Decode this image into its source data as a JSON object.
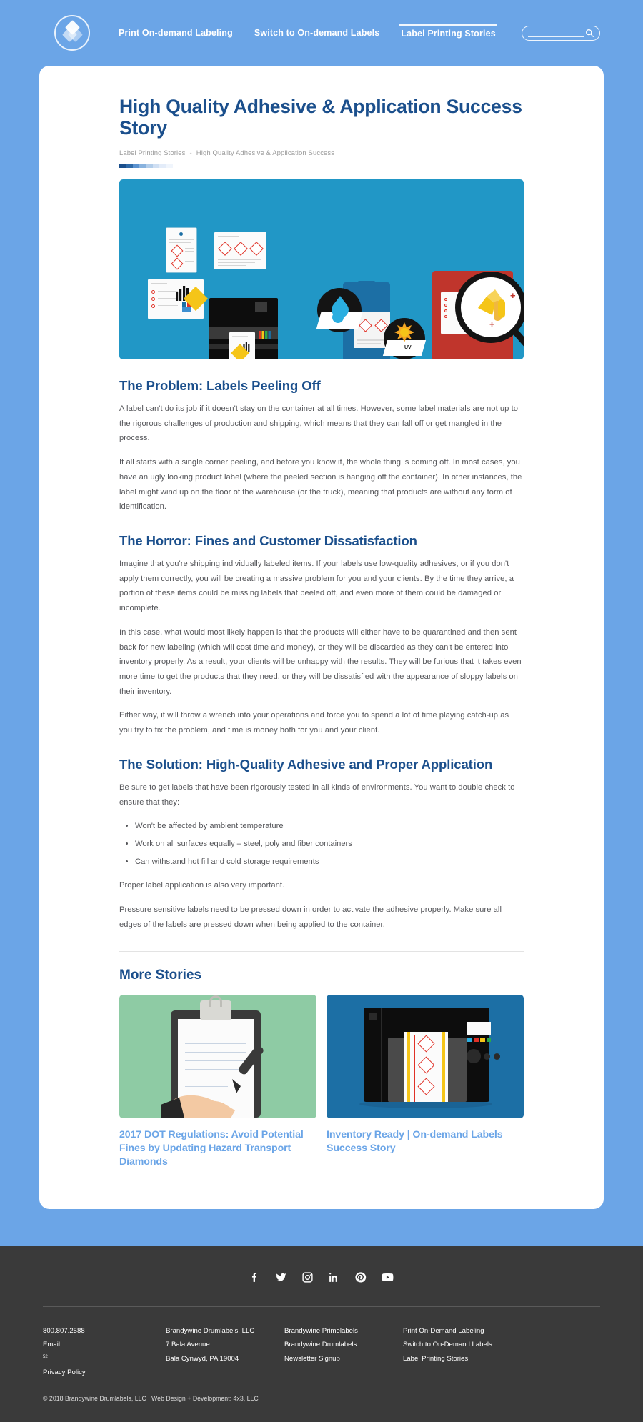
{
  "header": {
    "logo_name": "brandywine-logo",
    "nav": [
      {
        "label": "Print On-demand Labeling",
        "active": false
      },
      {
        "label": "Switch to On-demand Labels",
        "active": false
      },
      {
        "label": "Label Printing Stories",
        "active": true
      }
    ],
    "search": {
      "placeholder": "",
      "value": "",
      "icon": "search-icon"
    }
  },
  "article": {
    "title": "High Quality Adhesive & Application Success Story",
    "breadcrumb": {
      "parent": "Label Printing Stories",
      "separator": "-",
      "current": "High Quality Adhesive & Application Success"
    },
    "hero_alt": "label-printing-workflow-illustration",
    "sections": [
      {
        "heading": "The Problem: Labels Peeling Off",
        "paragraphs": [
          "A label can't do its job if it doesn't stay on the container at all times. However, some label materials are not up to the rigorous challenges of production and shipping, which means that they can fall off or get mangled in the process.",
          "It all starts with a single corner peeling, and before you know it, the whole thing is coming off. In most cases, you have an ugly looking product label (where the peeled section is hanging off the container). In other instances, the label might wind up on the floor of the warehouse (or the truck), meaning that products are without any form of identification."
        ]
      },
      {
        "heading": "The Horror: Fines and Customer Dissatisfaction",
        "paragraphs": [
          "Imagine that you're shipping individually labeled items. If your labels use low-quality adhesives, or if you don't apply them correctly, you will be creating a massive problem for you and your clients. By the time they arrive, a portion of these items could be missing labels that peeled off, and even more of them could be damaged or incomplete.",
          "In this case, what would most likely happen is that the products will either have to be quarantined and then sent back for new labeling (which will cost time and money), or they will be discarded as they can't be entered into inventory properly. As a result, your clients will be unhappy with the results. They will be furious that it takes even more time to get the products that they need, or they will be dissatisfied with the appearance of sloppy labels on their inventory.",
          "Either way, it will throw a wrench into your operations and force you to spend a lot of time playing catch-up as you try to fix the problem, and time is money both for you and your client."
        ]
      },
      {
        "heading": "The Solution: High-Quality Adhesive and Proper Application",
        "paragraphs": [
          "Be sure to get labels that have been rigorously tested in all kinds of environments. You want to double check to ensure that they:"
        ],
        "list": [
          "Won't be affected by ambient temperature",
          "Work on all surfaces equally – steel, poly and fiber containers",
          "Can withstand hot fill and cold storage requirements"
        ],
        "paragraphs_after": [
          "Proper label application is also very important.",
          "Pressure sensitive labels need to be pressed down in order to activate the adhesive properly. Make sure all edges of the labels are pressed down when being applied to the container."
        ]
      }
    ]
  },
  "more_stories": {
    "heading": "More Stories",
    "cards": [
      {
        "title": "2017 DOT Regulations: Avoid Potential Fines by Updating Hazard Transport Diamonds",
        "thumb_alt": "clipboard-hand-writing-illustration",
        "thumb_bg": "#8ecba4"
      },
      {
        "title": "Inventory Ready | On-demand Labels Success Story",
        "thumb_alt": "label-printer-illustration",
        "thumb_bg": "#1c6fa5"
      }
    ]
  },
  "footer": {
    "social": [
      {
        "name": "facebook-icon",
        "glyph": "f"
      },
      {
        "name": "twitter-icon",
        "glyph": "t"
      },
      {
        "name": "instagram-icon",
        "glyph": "i"
      },
      {
        "name": "linkedin-icon",
        "glyph": "in"
      },
      {
        "name": "pinterest-icon",
        "glyph": "p"
      },
      {
        "name": "youtube-icon",
        "glyph": "yt"
      }
    ],
    "columns": [
      {
        "items": [
          {
            "label": "800.807.2588",
            "sup": ""
          },
          {
            "label": "Email",
            "sup": "52"
          },
          {
            "label": "Privacy Policy",
            "sup": ""
          }
        ]
      },
      {
        "items": [
          {
            "label": "Brandywine Drumlabels, LLC",
            "sup": ""
          },
          {
            "label": "7 Bala Avenue",
            "sup": ""
          },
          {
            "label": "Bala Cynwyd, PA 19004",
            "sup": ""
          }
        ]
      },
      {
        "items": [
          {
            "label": "Brandywine Primelabels",
            "sup": ""
          },
          {
            "label": "Brandywine Drumlabels",
            "sup": ""
          },
          {
            "label": "Newsletter Signup",
            "sup": ""
          }
        ]
      },
      {
        "items": [
          {
            "label": "Print On-Demand Labeling",
            "sup": ""
          },
          {
            "label": "Switch to On-Demand Labels",
            "sup": ""
          },
          {
            "label": "Label Printing Stories",
            "sup": ""
          }
        ]
      }
    ],
    "copyright": "© 2018 Brandywine Drumlabels, LLC | Web Design + Development: 4x3, LLC"
  },
  "colors": {
    "page_bg": "#6ba5e7",
    "heading_blue": "#1b4f8c",
    "hero_blue": "#2197c6",
    "link_blue": "#6ba5e7",
    "footer_bg": "#3a3a3a",
    "body_text": "#55565a"
  }
}
